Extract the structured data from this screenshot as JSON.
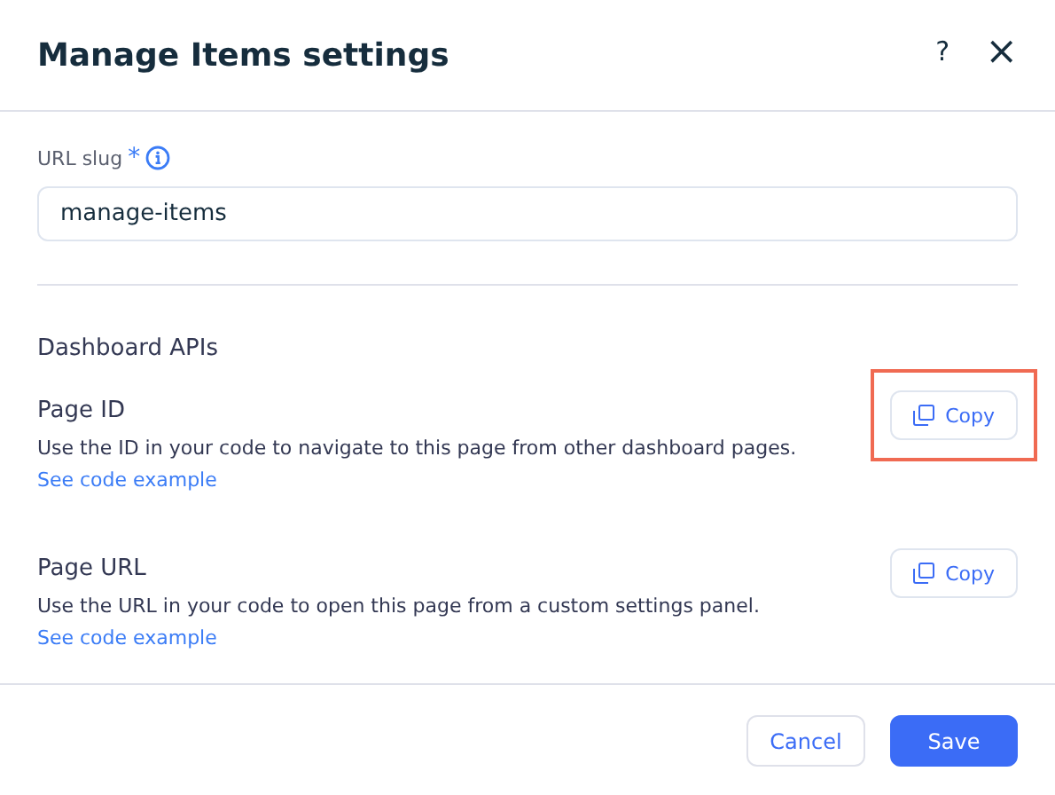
{
  "dialog": {
    "title": "Manage Items settings",
    "help": "?",
    "close": "×"
  },
  "slug": {
    "label": "URL slug",
    "required": "*",
    "value": "manage-items"
  },
  "section": {
    "title": "Dashboard APIs"
  },
  "apis": [
    {
      "title": "Page ID",
      "description": "Use the ID in your code to navigate to this page from other dashboard pages.",
      "link": "See code example",
      "button": "Copy",
      "highlighted": true
    },
    {
      "title": "Page URL",
      "description": "Use the URL in your code to open this page from a custom settings panel.",
      "link": "See code example",
      "button": "Copy",
      "highlighted": false
    }
  ],
  "footer": {
    "buttons": [
      {
        "label": "Cancel",
        "kind": "secondary"
      },
      {
        "label": "Save",
        "kind": "primary"
      }
    ]
  }
}
